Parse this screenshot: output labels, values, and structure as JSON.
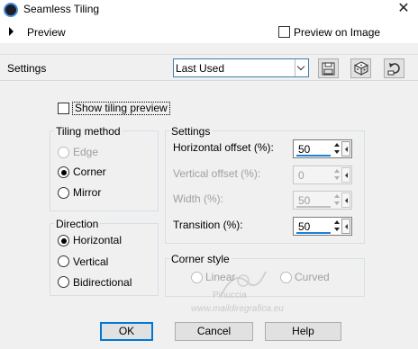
{
  "window": {
    "title": "Seamless Tiling",
    "close_icon": "close-icon"
  },
  "preview": {
    "label": "Preview",
    "preview_on_image_label": "Preview on Image",
    "preview_on_image_checked": false
  },
  "settings_bar": {
    "label": "Settings",
    "preset_value": "Last Used",
    "icons": [
      "save-preset-icon",
      "randomize-icon",
      "reset-icon"
    ]
  },
  "show_tiling_preview": {
    "label": "Show tiling preview",
    "checked": false
  },
  "tiling_method": {
    "title": "Tiling method",
    "options": [
      {
        "label": "Edge",
        "selected": false,
        "enabled": false
      },
      {
        "label": "Corner",
        "selected": true,
        "enabled": true
      },
      {
        "label": "Mirror",
        "selected": false,
        "enabled": true
      }
    ]
  },
  "direction": {
    "title": "Direction",
    "options": [
      {
        "label": "Horizontal",
        "selected": true
      },
      {
        "label": "Vertical",
        "selected": false
      },
      {
        "label": "Bidirectional",
        "selected": false
      }
    ]
  },
  "settings": {
    "title": "Settings",
    "fields": [
      {
        "label": "Horizontal offset (%):",
        "value": "50",
        "enabled": true
      },
      {
        "label": "Vertical offset (%):",
        "value": "0",
        "enabled": false
      },
      {
        "label": "Width (%):",
        "value": "50",
        "enabled": false
      },
      {
        "label": "Transition (%):",
        "value": "50",
        "enabled": true
      }
    ]
  },
  "corner_style": {
    "title": "Corner style",
    "options": [
      {
        "label": "Linear",
        "selected": false,
        "enabled": false
      },
      {
        "label": "Curved",
        "selected": false,
        "enabled": false
      }
    ]
  },
  "buttons": {
    "ok": "OK",
    "cancel": "Cancel",
    "help": "Help"
  },
  "watermark": {
    "line1": "Pinuccia",
    "line2": "www.maildiregrafica.eu"
  }
}
